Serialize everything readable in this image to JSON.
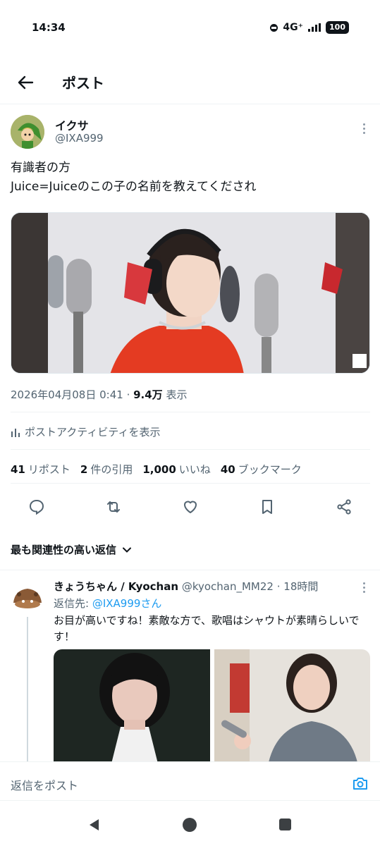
{
  "status_bar": {
    "time": "14:34",
    "network": "4G⁺",
    "battery": "100"
  },
  "header": {
    "title": "ポスト"
  },
  "post": {
    "author_name": "イクサ",
    "author_handle": "@IXA999",
    "text_line1": "有識者の方",
    "text_line2": "Juice=Juiceのこの子の名前を教えてくだされ",
    "timestamp": "2026年04月08日 0:41 · ",
    "views": "9.4万",
    "views_label": " 表示",
    "activity_label": "ポストアクティビティを表示",
    "stats": {
      "reposts_count": "41",
      "reposts_label": "リポスト",
      "quotes_count": "2",
      "quotes_label": "件の引用",
      "likes_count": "1,000",
      "likes_label": "いいね",
      "bookmarks_count": "40",
      "bookmarks_label": "ブックマーク"
    },
    "action_icons": [
      "reply-icon",
      "repost-icon",
      "like-icon",
      "bookmark-icon",
      "share-icon"
    ]
  },
  "sort_label": "最も関連性の高い返信",
  "reply": {
    "author_name": "きょうちゃん / Kyochan",
    "author_handle": "@kyochan_MM22",
    "time": " · 18時間",
    "reply_to_label": "返信先: ",
    "reply_to_handle": "@IXA999さん",
    "text": "お目が高いですね！素敵な方で、歌唱はシャウトが素晴らしいです！"
  },
  "composer": {
    "placeholder": "返信をポスト"
  },
  "colors": {
    "accent": "#1d9bf0",
    "text": "#0f1419",
    "muted": "#536471",
    "border": "#eff3f4"
  }
}
